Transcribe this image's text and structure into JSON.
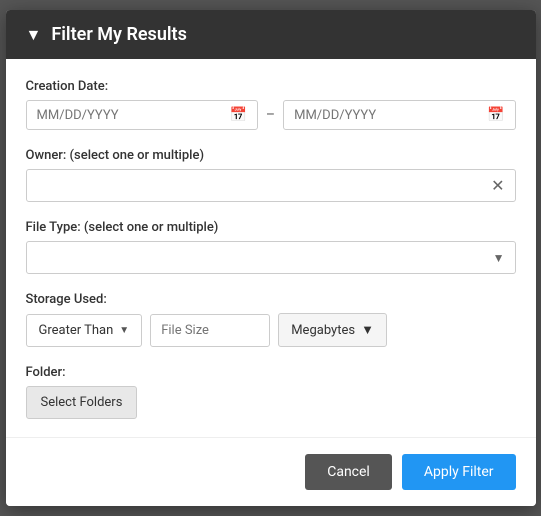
{
  "modal": {
    "title": "Filter My Results",
    "header_icon": "▼"
  },
  "form": {
    "creation_date_label": "Creation Date:",
    "date_placeholder": "MM/DD/YYYY",
    "date_separator": "–",
    "owner_label": "Owner: (select one or multiple)",
    "owner_placeholder": "",
    "file_type_label": "File Type: (select one or multiple)",
    "file_type_placeholder": "",
    "storage_used_label": "Storage Used:",
    "greater_than_label": "Greater Than",
    "file_size_placeholder": "File Size",
    "megabytes_label": "Megabytes",
    "folder_label": "Folder:",
    "select_folders_label": "Select Folders"
  },
  "footer": {
    "cancel_label": "Cancel",
    "apply_label": "Apply Filter"
  }
}
